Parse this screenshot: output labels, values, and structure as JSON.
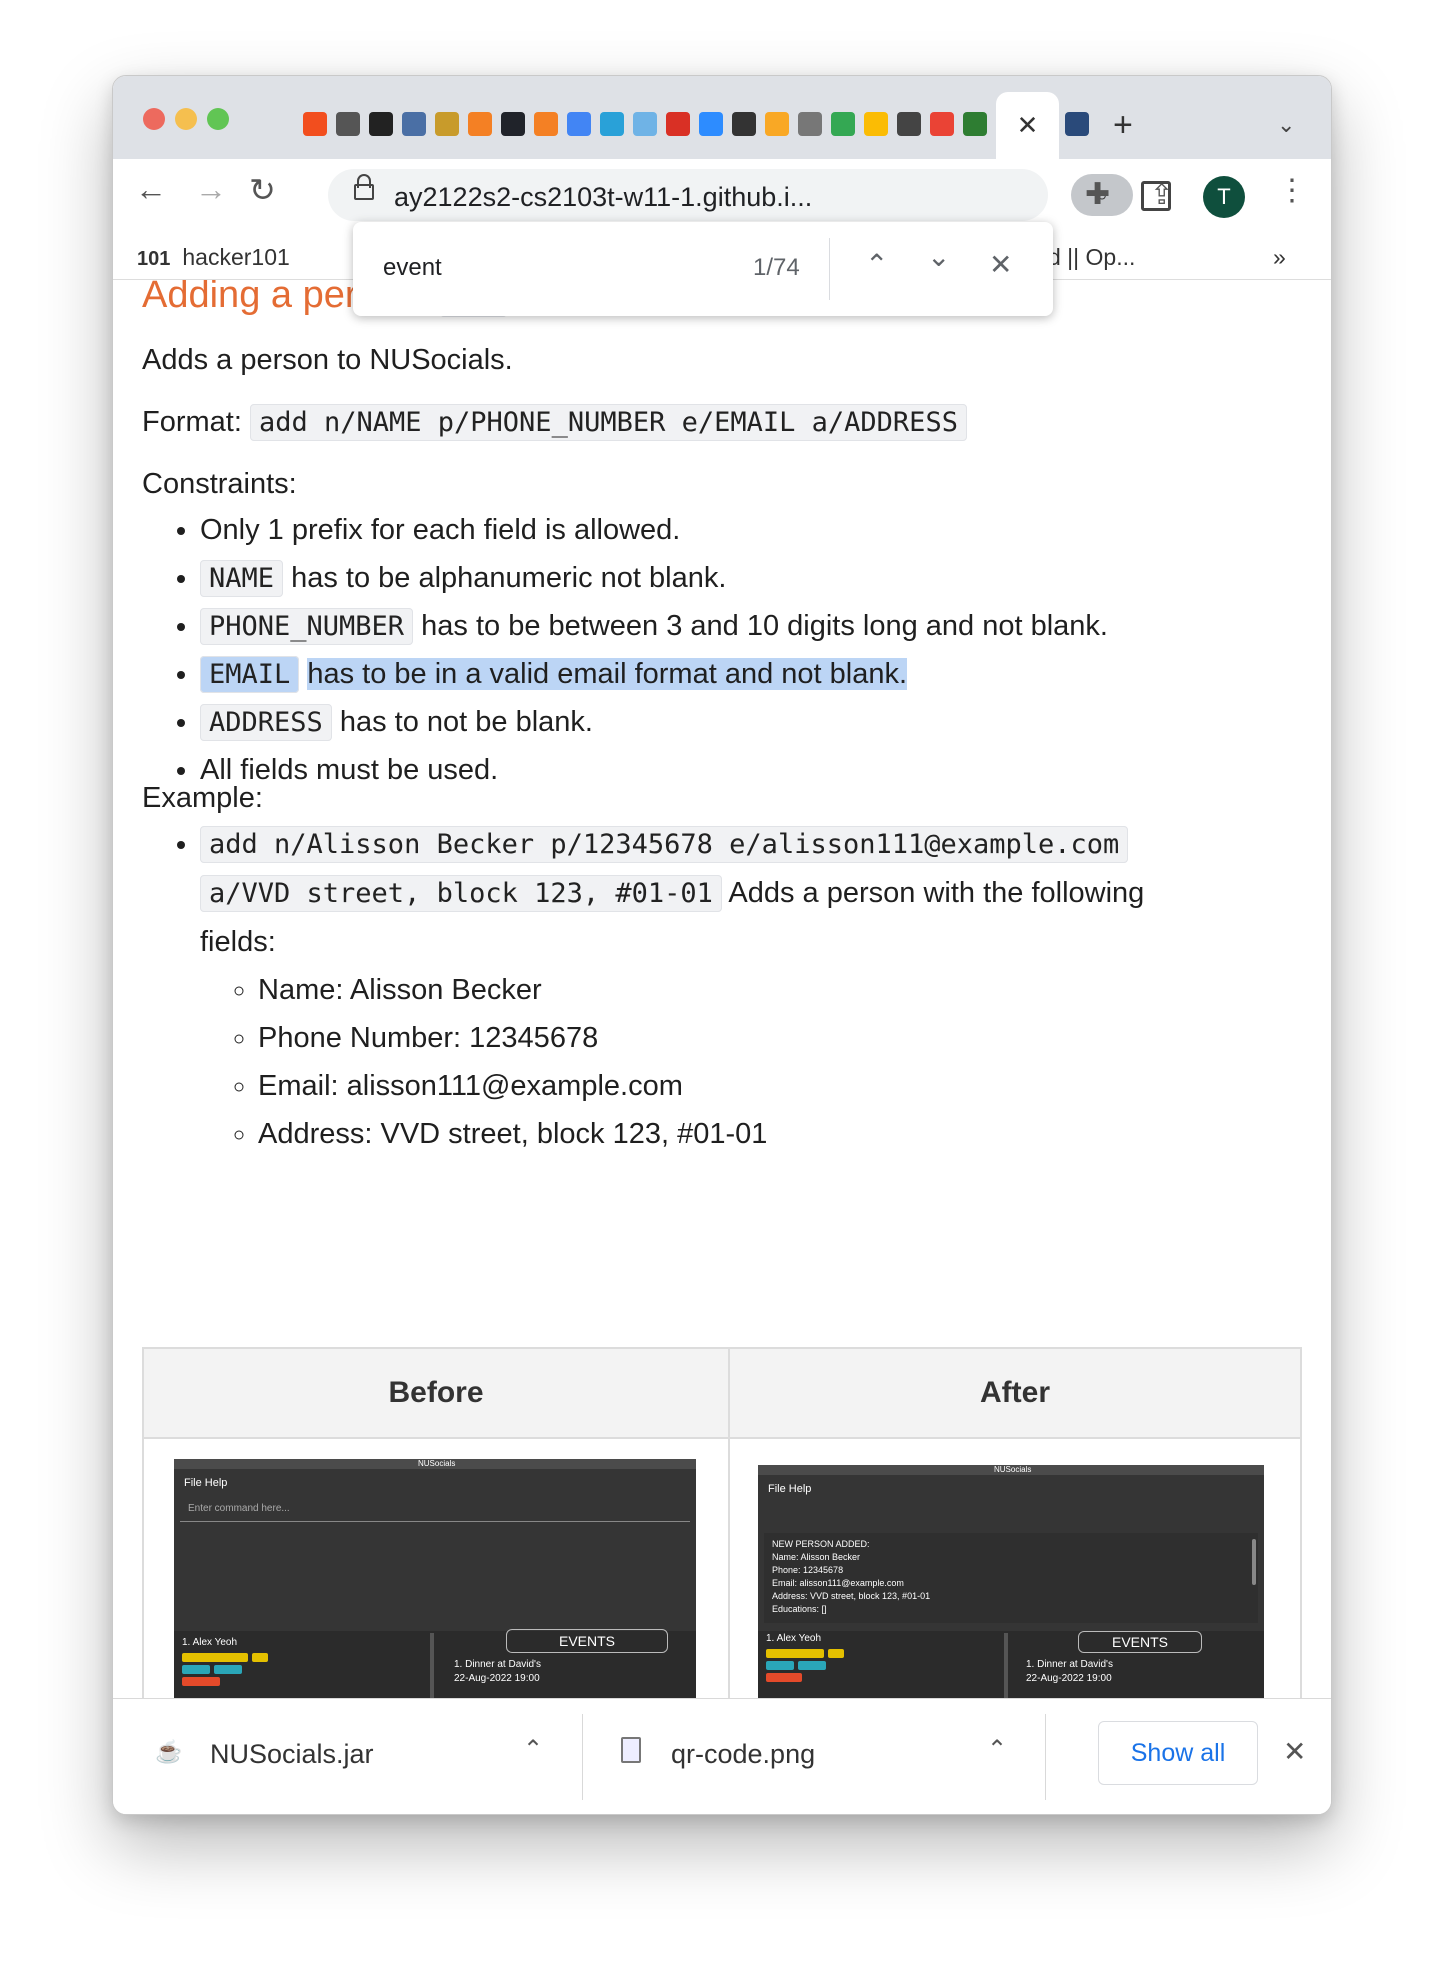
{
  "window": {
    "buttons": {
      "close_color": "#ed6a5e",
      "minimize_color": "#f5bf4f",
      "maximize_color": "#61c554"
    },
    "tabs": {
      "active_close": "✕",
      "new_tab": "+",
      "list_chevron": "⌄"
    }
  },
  "toolbar": {
    "url": "ay2122s2-cs2103t-w11-1.github.i...",
    "avatar_letter": "T"
  },
  "bookmarks": [
    {
      "label": "hacker101",
      "prefix": "101"
    },
    {
      "label": "d || Op..."
    }
  ],
  "bookmarks_more": "»",
  "findbar": {
    "query": "event",
    "count": "1/74"
  },
  "doc": {
    "heading": "Adding a person:",
    "heading_code": "add",
    "intro": "Adds a person to NUSocials.",
    "format_label": "Format:",
    "format_code": "add n/NAME p/PHONE_NUMBER e/EMAIL a/ADDRESS",
    "constraints_label": "Constraints:",
    "constraints": [
      {
        "code": "",
        "text": "Only 1 prefix for each field is allowed."
      },
      {
        "code": "NAME",
        "text": "has to be alphanumeric not blank."
      },
      {
        "code": "PHONE_NUMBER",
        "text": "has to be between 3 and 10 digits long and not blank."
      },
      {
        "code": "EMAIL",
        "text": "has to be in a valid email format and not blank."
      },
      {
        "code": "ADDRESS",
        "text": "has to not be blank."
      },
      {
        "code": "",
        "text": "All fields must be used."
      }
    ],
    "example_label": "Example:",
    "example_code_1": "add n/Alisson Becker p/12345678 e/alisson111@example.com",
    "example_code_2": "a/VVD street, block 123, #01-01",
    "example_text": "Adds a person with the following",
    "example_text_2": "fields:",
    "example_fields": [
      "Name: Alisson Becker",
      "Phone Number: 12345678",
      "Email: alisson111@example.com",
      "Address: VVD street, block 123, #01-01"
    ],
    "table_headers": [
      "Before",
      "After"
    ],
    "before_shot": {
      "title": "NUSocials",
      "menu": "File   Help",
      "placeholder": "Enter command here...",
      "person": "1.  Alex Yeoh",
      "events_button": "EVENTS",
      "event_item": "1.  Dinner at David's",
      "event_date": "22-Aug-2022 19:00"
    },
    "after_shot": {
      "title": "NUSocials",
      "menu": "File   Help",
      "result_lines": [
        "NEW PERSON ADDED:",
        "Name: Alisson Becker",
        "Phone: 12345678",
        "Email: alisson111@example.com",
        "Address: VVD street, block 123, #01-01",
        "Educations: []"
      ],
      "person": "1.  Alex Yeoh",
      "events_button": "EVENTS",
      "event_item": "1.  Dinner at David's",
      "event_date": "22-Aug-2022 19:00"
    }
  },
  "downloads": {
    "items": [
      {
        "name": "NUSocials.jar"
      },
      {
        "name": "qr-code.png"
      }
    ],
    "show_all": "Show all",
    "close": "✕"
  }
}
